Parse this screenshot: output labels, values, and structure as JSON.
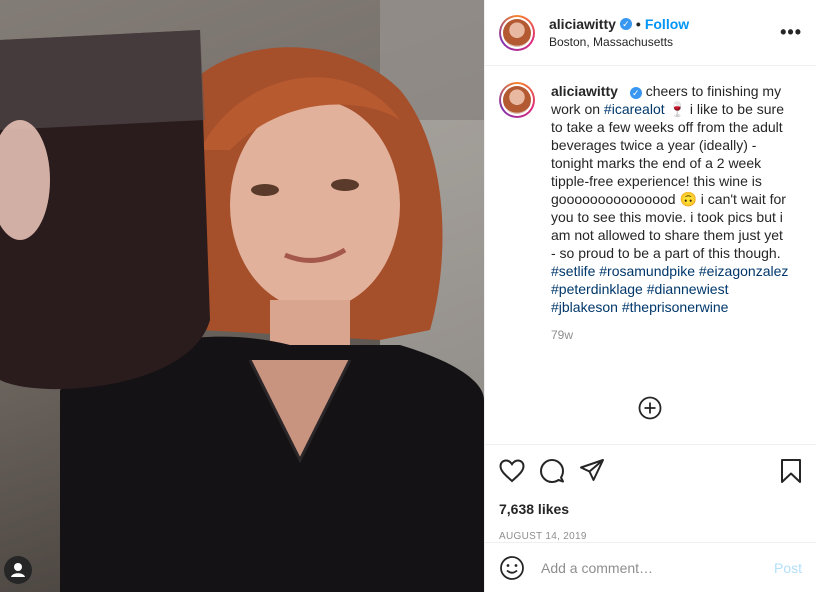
{
  "header": {
    "username": "aliciawitty",
    "dot": "•",
    "follow_label": "Follow",
    "location": "Boston, Massachusetts",
    "more_label": "•••"
  },
  "caption": {
    "username": "aliciawitty",
    "part1": "cheers to finishing my work on",
    "tag1": "#icarealot",
    "emoji1": "🍷",
    "part2": "i like to be sure to take a few weeks off from the adult beverages twice a year (ideally) - tonight marks the end of a 2 week tipple-free experience! this wine is gooooooooooooood",
    "emoji2": "🙃",
    "part3": "i can't wait for you to see this movie. i took pics but i am not allowed to share them just yet - so proud to be a part of this though.",
    "hashtags": [
      "#setlife",
      "#rosamundpike",
      "#eizagonzalez",
      "#peterdinklage",
      "#diannewiest",
      "#jblakeson",
      "#theprisonerwine"
    ],
    "age": "79w"
  },
  "stats": {
    "likes": "7,638 likes",
    "date": "AUGUST 14, 2019"
  },
  "add_comment": {
    "placeholder": "Add a comment…",
    "post_label": "Post"
  },
  "icons": {
    "verified": "verified-badge-icon",
    "like": "heart-icon",
    "comment": "comment-bubble-icon",
    "share": "paper-plane-icon",
    "save": "bookmark-icon",
    "load_more": "plus-circle-icon",
    "emoji": "smiley-icon",
    "user_tags": "user-icon"
  },
  "colors": {
    "link": "#00376b",
    "follow": "#0095f6",
    "verified": "#3897f0",
    "muted": "#8e8e8e",
    "post_disabled": "#b2dffc"
  }
}
